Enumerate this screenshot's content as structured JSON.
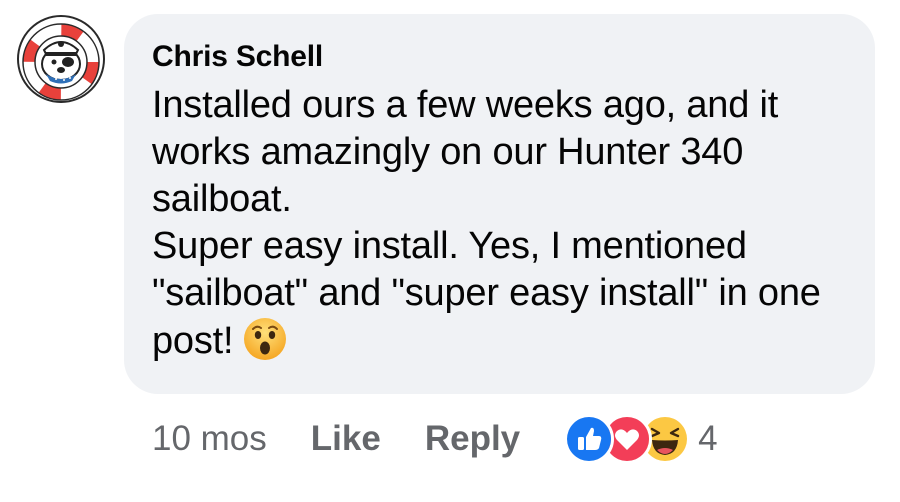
{
  "comment": {
    "author": "Chris Schell",
    "lines": [
      "Installed ours a few weeks ago, and it works amazingly on our Hunter 340 sailboat.",
      "Super easy install. Yes, I mentioned \"sailboat\" and \"super easy install\" in one post!"
    ],
    "inline_emoji": "surprised-face-icon"
  },
  "actions": {
    "timestamp": "10 mos",
    "like_label": "Like",
    "reply_label": "Reply"
  },
  "reactions": {
    "icons": [
      "like-reaction-icon",
      "love-reaction-icon",
      "haha-reaction-icon"
    ],
    "count": "4"
  },
  "colors": {
    "bubble": "#f0f2f5",
    "secondary_text": "#65676b",
    "like_blue": "#1877f2",
    "love_red": "#f33e58",
    "haha_yellow": "#fcc843"
  }
}
